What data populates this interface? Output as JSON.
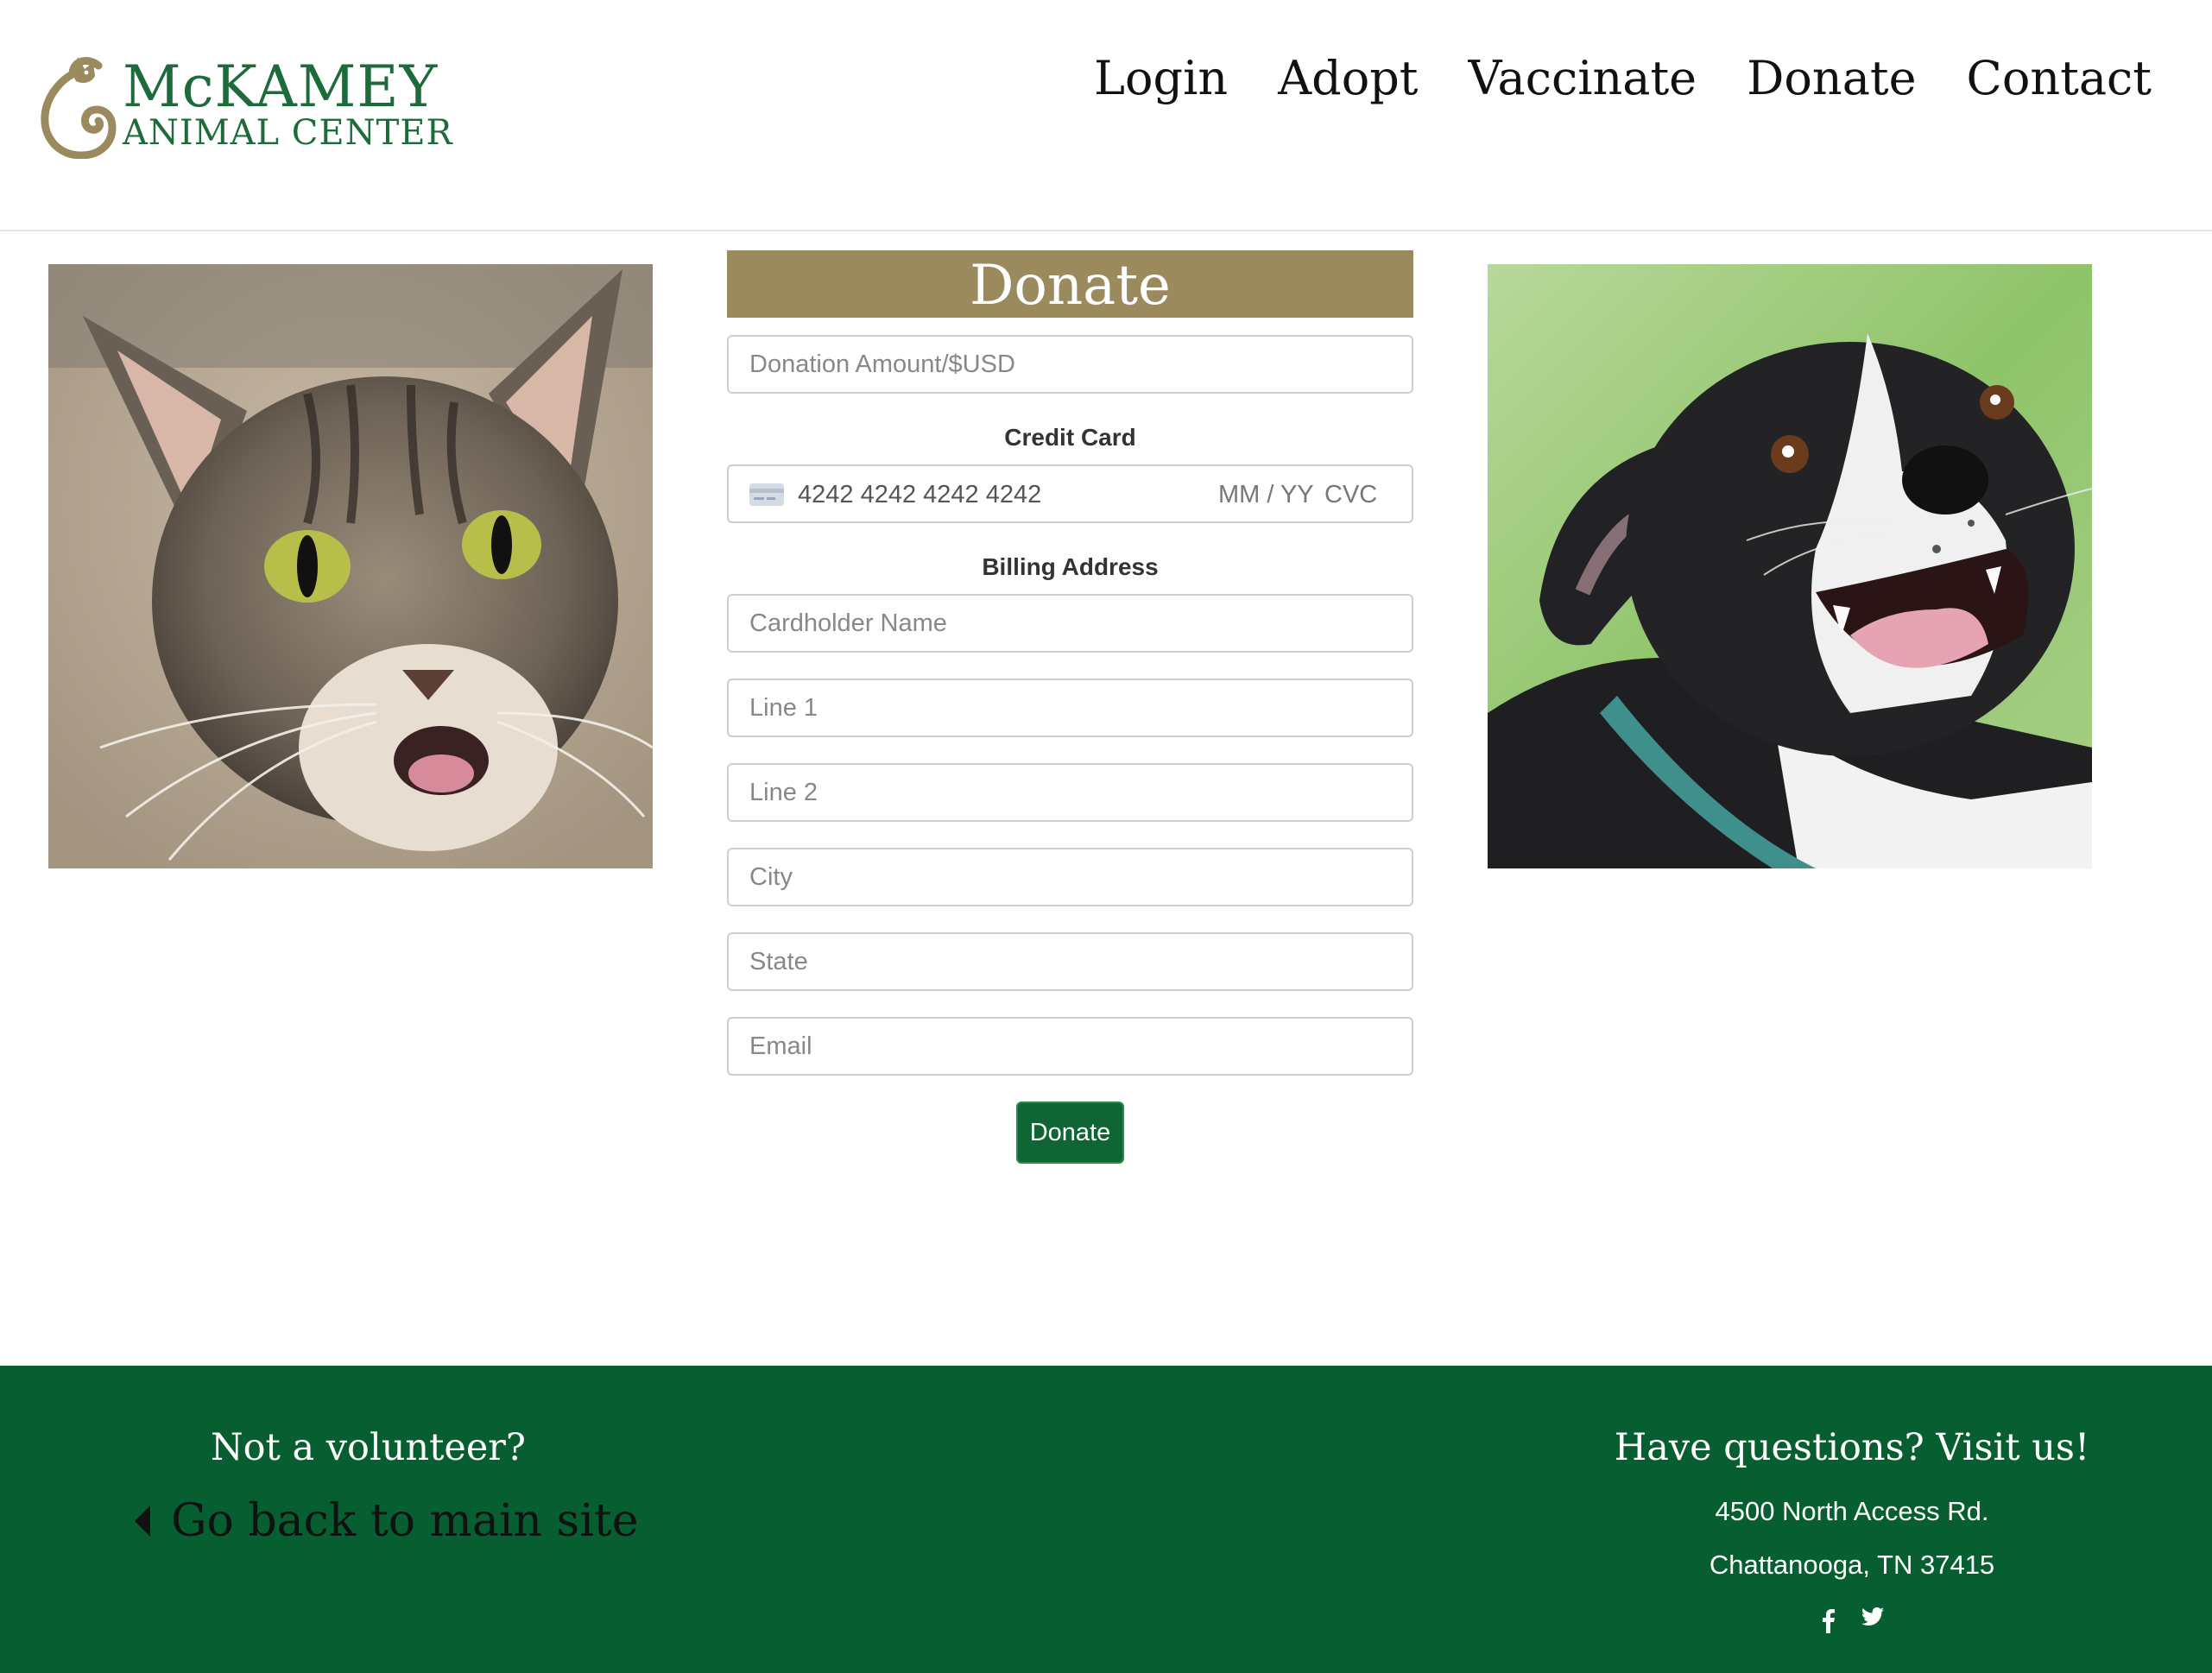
{
  "brand": {
    "name_line1": "McKAMEY",
    "name_line2": "ANIMAL CENTER",
    "primary_color": "#065e31",
    "accent_color": "#9a8a5e"
  },
  "nav": {
    "items": [
      {
        "label": "Login"
      },
      {
        "label": "Adopt"
      },
      {
        "label": "Vaccinate"
      },
      {
        "label": "Donate"
      },
      {
        "label": "Contact"
      }
    ]
  },
  "form": {
    "title": "Donate",
    "amount_placeholder": "Donation Amount/$USD",
    "credit_card_label": "Credit Card",
    "card_number": "4242 4242 4242 4242",
    "card_expiry_placeholder": "MM / YY",
    "card_cvc_placeholder": "CVC",
    "billing_label": "Billing Address",
    "cardholder_placeholder": "Cardholder Name",
    "line1_placeholder": "Line 1",
    "line2_placeholder": "Line 2",
    "city_placeholder": "City",
    "state_placeholder": "State",
    "email_placeholder": "Email",
    "submit_label": "Donate"
  },
  "footer": {
    "left_title": "Not a volunteer?",
    "back_link": "Go back to main site",
    "right_title": "Have questions? Visit us!",
    "address_line1": "4500 North Access Rd.",
    "address_line2": "Chattanooga, TN 37415",
    "socials": [
      {
        "icon": "facebook-icon"
      },
      {
        "icon": "twitter-icon"
      }
    ]
  },
  "images": {
    "left": "cat-photo",
    "right": "dog-photo"
  }
}
